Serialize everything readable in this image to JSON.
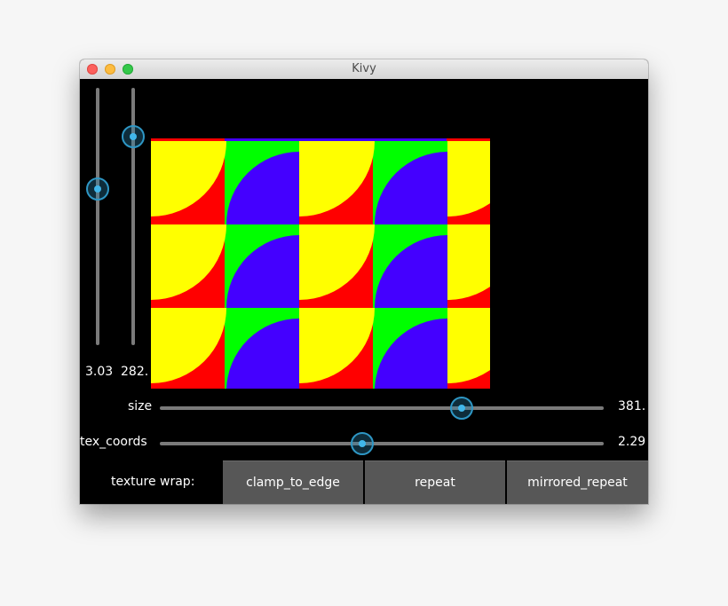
{
  "window": {
    "title": "Kivy"
  },
  "sliders": {
    "left_value": "3.03",
    "right_value": "282.",
    "size": {
      "label": "size",
      "value": "381.",
      "fraction": 0.7
    },
    "tex_coords": {
      "label": "tex_coords",
      "value": "2.29",
      "fraction": 0.457
    }
  },
  "texture_wrap": {
    "label": "texture wrap:",
    "buttons": [
      "clamp_to_edge",
      "repeat",
      "mirrored_repeat"
    ]
  },
  "colors": {
    "red": "#ff0000",
    "yellow": "#ffff00",
    "green": "#00ff00",
    "blue": "#4400ff",
    "accent": "#2e97c5"
  }
}
